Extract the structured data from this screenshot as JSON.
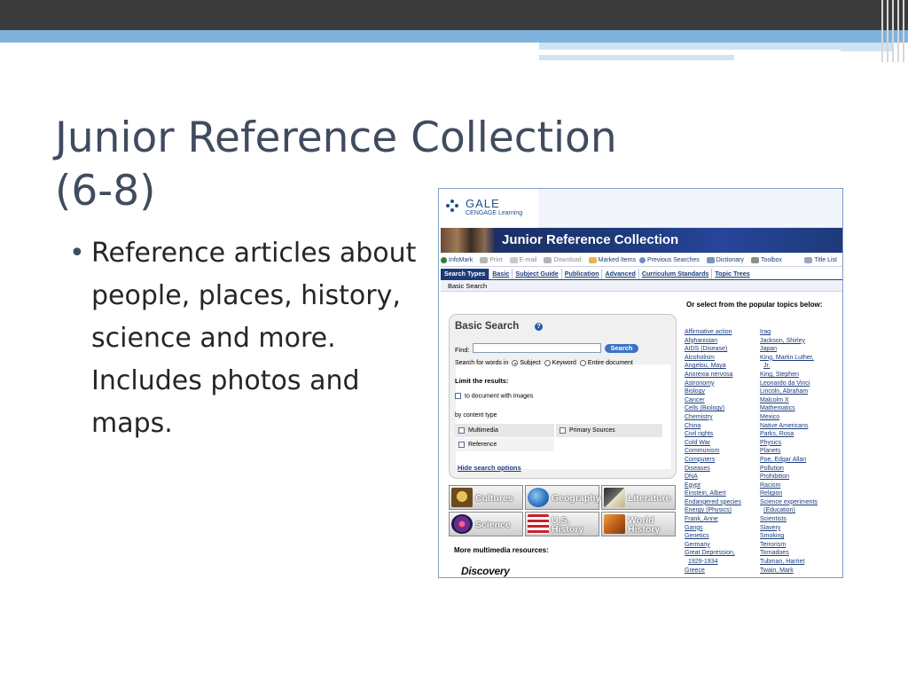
{
  "slide": {
    "title_line1": "Junior Reference Collection",
    "title_line2": "(6-8)",
    "bullets": [
      "Reference articles about people, places, history, science and more. Includes photos and maps."
    ]
  },
  "screenshot": {
    "brand": {
      "name": "GALE",
      "sub": "CENGAGE Learning"
    },
    "banner_title": "Junior Reference Collection",
    "toolbar": [
      {
        "label": "InfoMark",
        "icon": "infomark-icon",
        "enabled": true
      },
      {
        "label": "Print",
        "icon": "print-icon",
        "enabled": false
      },
      {
        "label": "E-mail",
        "icon": "email-icon",
        "enabled": false
      },
      {
        "label": "Download",
        "icon": "download-icon",
        "enabled": false
      },
      {
        "label": "Marked Items",
        "icon": "folder-icon",
        "enabled": true
      },
      {
        "label": "Previous Searches",
        "icon": "magnifier-icon",
        "enabled": true
      },
      {
        "label": "Dictionary",
        "icon": "book-icon",
        "enabled": true
      },
      {
        "label": "Toolbox",
        "icon": "tools-icon",
        "enabled": true
      },
      {
        "label": "Title List",
        "icon": "list-icon",
        "enabled": true
      }
    ],
    "nav_tabs": [
      "Search Types",
      "Basic",
      "Subject Guide",
      "Publication",
      "Advanced",
      "Curriculum Standards",
      "Topic Trees"
    ],
    "sub_tab": "Basic Search",
    "search": {
      "title": "Basic Search",
      "help": "?",
      "find_label": "Find:",
      "find_value": "",
      "button": "Search",
      "words_label": "Search for words in",
      "options": [
        "Subject",
        "Keyword",
        "Entire document"
      ],
      "selected_option": "Subject",
      "limit_label": "Limit the results:",
      "images_label": "to document with images",
      "content_type_label": "by content type",
      "content_types": [
        "Multimedia",
        "Primary Sources",
        "Reference"
      ],
      "hide_link": "Hide search options"
    },
    "tiles": [
      {
        "label": "Cultures",
        "icon": "mask-icon"
      },
      {
        "label": "Geography",
        "icon": "globe-icon"
      },
      {
        "label": "Literature",
        "icon": "open-book-icon"
      },
      {
        "label": "Science",
        "icon": "atom-icon"
      },
      {
        "label": "U.S. History",
        "icon": "flag-icon"
      },
      {
        "label": "World History",
        "icon": "pyramid-icon"
      }
    ],
    "more_multimedia": "More multimedia resources:",
    "discovery": "Discovery",
    "popular_heading": "Or select from the popular topics below:",
    "topics_left": [
      "Affirmative action",
      "Afghanistan",
      "AIDS (Disease)",
      "Alcoholism",
      "Angelou, Maya",
      "Anorexia nervosa",
      "Astronomy",
      "Biology",
      "Cancer",
      "Cells (Biology)",
      "Chemistry",
      "China",
      "Civil rights",
      "Cold War",
      "Communism",
      "Computers",
      "Diseases",
      "DNA",
      "Egypt",
      "Einstein, Albert",
      "Endangered species",
      "Energy (Physics)",
      "Frank, Anne",
      "Gangs",
      "Genetics",
      "Germany",
      "Great Depression,",
      "1929-1934",
      "Greece"
    ],
    "topics_right": [
      "Iraq",
      "Jackson, Shirley",
      "Japan",
      "King, Martin Luther,",
      "Jr.",
      "King, Stephen",
      "Leonardo da Vinci",
      "Lincoln, Abraham",
      "Malcolm X",
      "Mathematics",
      "Mexico",
      "Native Americans",
      "Parks, Rosa",
      "Physics",
      "Planets",
      "Poe, Edgar Allan",
      "Pollution",
      "Prohibition",
      "Racism",
      "Religion",
      "Science experiments",
      "(Education)",
      "Scientists",
      "Slavery",
      "Smoking",
      "Terrorism",
      "Tornadoes",
      "Tubman, Harriet",
      "Twain, Mark"
    ]
  }
}
